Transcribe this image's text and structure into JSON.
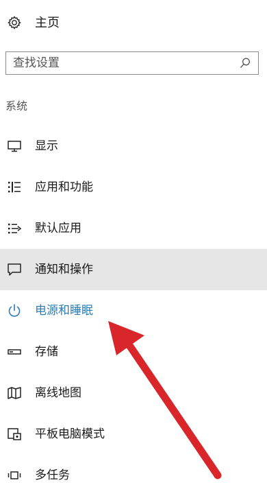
{
  "home": {
    "label": "主页",
    "icon": "gear-icon"
  },
  "search": {
    "placeholder": "查找设置",
    "value": "",
    "icon": "search-icon"
  },
  "section_title": "系统",
  "colors": {
    "accent": "#2b7cb7",
    "selected_bg": "#e6e6e6",
    "arrow": "#d9262b"
  },
  "menu": [
    {
      "label": "显示",
      "icon": "monitor-icon"
    },
    {
      "label": "应用和功能",
      "icon": "list-icon"
    },
    {
      "label": "默认应用",
      "icon": "default-apps-icon"
    },
    {
      "label": "通知和操作",
      "icon": "speech-bubble-icon"
    },
    {
      "label": "电源和睡眠",
      "icon": "power-icon"
    },
    {
      "label": "存储",
      "icon": "storage-icon"
    },
    {
      "label": "离线地图",
      "icon": "map-icon"
    },
    {
      "label": "平板电脑模式",
      "icon": "tablet-mode-icon"
    },
    {
      "label": "多任务",
      "icon": "multitask-icon"
    }
  ],
  "selected_item": "通知和操作",
  "active_item": "电源和睡眠"
}
